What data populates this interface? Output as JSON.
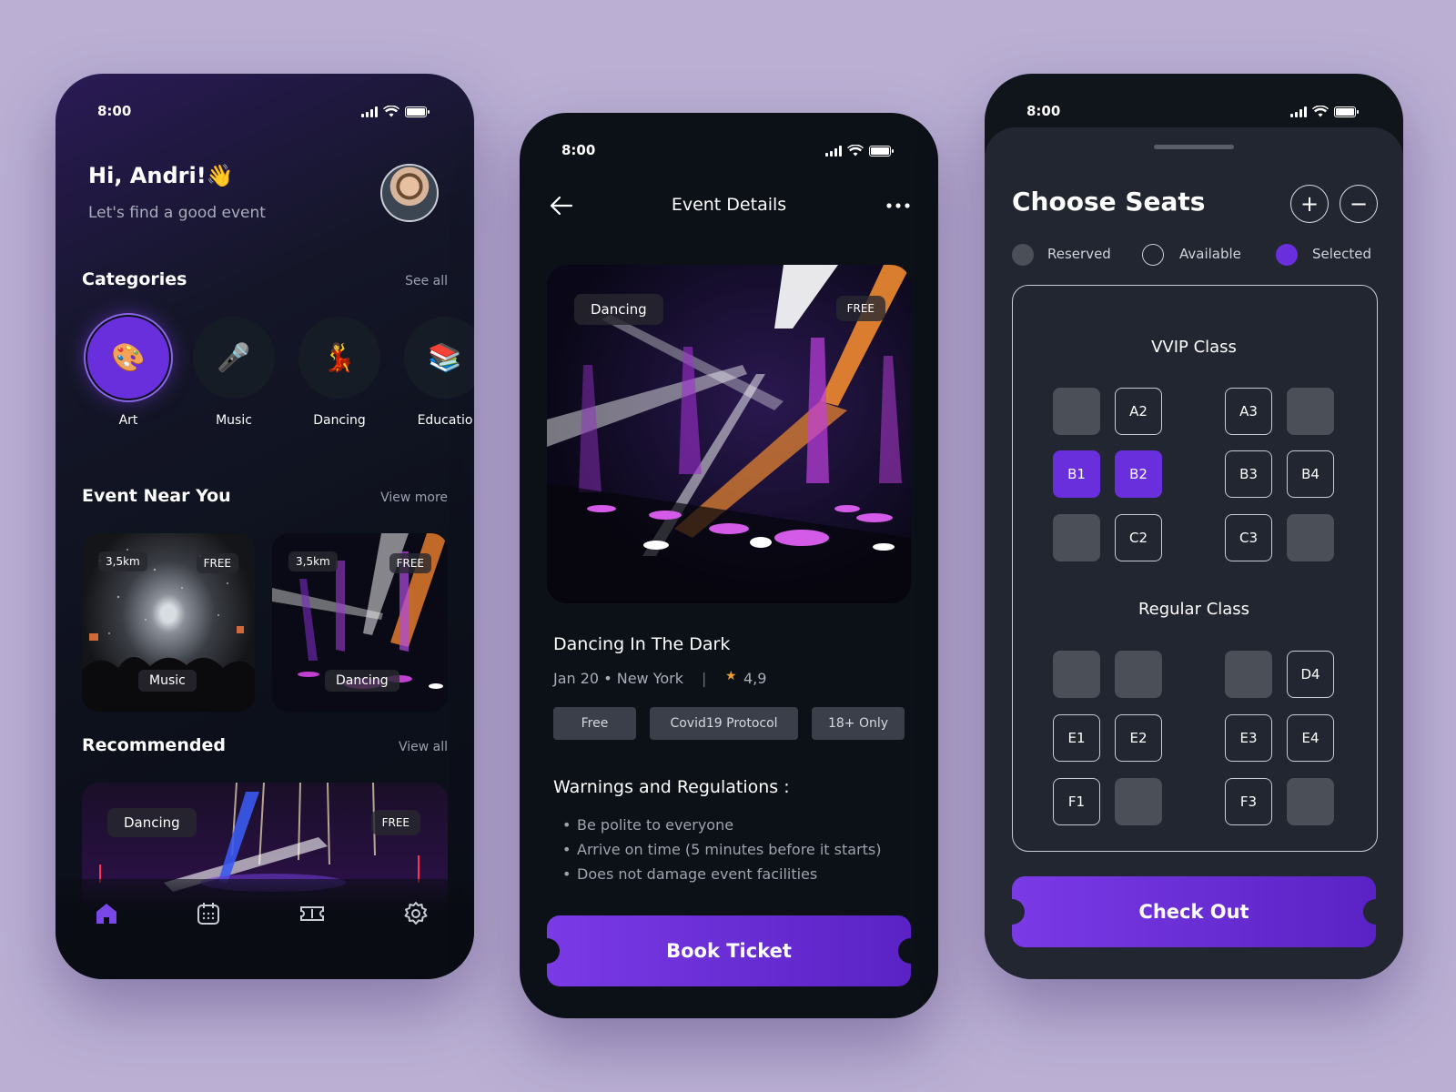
{
  "status": {
    "time": "8:00"
  },
  "home": {
    "greeting": "Hi, Andri!👋",
    "subtitle": "Let's find a good event",
    "categories": {
      "title": "Categories",
      "link": "See all",
      "items": [
        {
          "label": "Art",
          "icon": "🎨"
        },
        {
          "label": "Music",
          "icon": "🎤"
        },
        {
          "label": "Dancing",
          "icon": "💃"
        },
        {
          "label": "Educatio",
          "icon": "📚"
        }
      ]
    },
    "near": {
      "title": "Event Near You",
      "link": "View more",
      "cards": [
        {
          "distance": "3,5km",
          "price": "FREE",
          "category": "Music"
        },
        {
          "distance": "3,5km",
          "price": "FREE",
          "category": "Dancing"
        }
      ]
    },
    "recommended": {
      "title": "Recommended",
      "link": "View all",
      "card": {
        "category": "Dancing",
        "price": "FREE"
      }
    },
    "nav": [
      "home-icon",
      "calendar-icon",
      "ticket-icon",
      "settings-icon"
    ]
  },
  "details": {
    "header": "Event Details",
    "image_tag": "Dancing",
    "image_price": "FREE",
    "title": "Dancing In The Dark",
    "meta": "Jan 20 • New York",
    "separator": "|",
    "rating": "4,9",
    "chips": [
      "Free",
      "Covid19 Protocol",
      "18+ Only"
    ],
    "warnings_title": "Warnings and Regulations :",
    "rules": [
      "Be polite to everyone",
      "Arrive on time (5 minutes before it starts)",
      "Does not damage event facilities"
    ],
    "cta": "Book Ticket"
  },
  "seats": {
    "title": "Choose Seats",
    "plus": "+",
    "minus": "−",
    "legend": {
      "reserved": "Reserved",
      "available": "Available",
      "selected": "Selected"
    },
    "vvip_title": "VVIP Class",
    "regular_title": "Regular Class",
    "vvip": [
      [
        "",
        "A2",
        "A3",
        ""
      ],
      [
        "B1",
        "B2",
        "B3",
        "B4"
      ],
      [
        "",
        "C2",
        "C3",
        ""
      ]
    ],
    "regular": [
      [
        "",
        "",
        "",
        "D4"
      ],
      [
        "E1",
        "E2",
        "E3",
        "E4"
      ],
      [
        "F1",
        "",
        "F3",
        ""
      ]
    ],
    "cta": "Check Out"
  },
  "colors": {
    "accent": "#6a2fdc",
    "background": "#bbb0d4"
  }
}
